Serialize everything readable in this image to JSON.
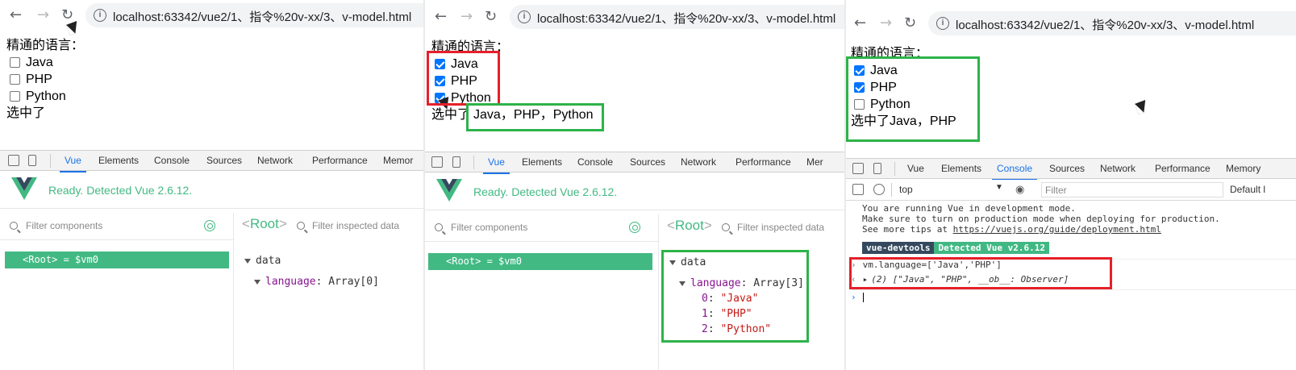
{
  "browser": {
    "url": "localhost:63342/vue2/1、指令%20v-xx/3、v-model.html",
    "url_icon": "info-icon"
  },
  "page": {
    "heading": "精通的语言：",
    "options": [
      "Java",
      "PHP",
      "Python"
    ],
    "selected_label": "选中了"
  },
  "devtools": {
    "tabs": [
      "Vue",
      "Elements",
      "Console",
      "Sources",
      "Network",
      "Performance",
      "Memory"
    ],
    "tabs_trunc": [
      "Vue",
      "Elements",
      "Console",
      "Sources",
      "Network",
      "Performance",
      "Memor"
    ],
    "tabs_trunc2": [
      "Vue",
      "Elements",
      "Console",
      "Sources",
      "Network",
      "Performance",
      "Mer"
    ]
  },
  "vue_panel": {
    "ready_text": "Ready. Detected Vue 2.6.12.",
    "filter_components": "Filter components",
    "filter_inspected": "Filter inspected data",
    "root_tag_open": "<",
    "root_tag_name": "Root",
    "root_tag_close": ">",
    "root_row": "<Root>",
    "root_row_eq": " = ",
    "root_row_vm": "$vm0",
    "data_label": "data",
    "language_key": "language",
    "colon": ": "
  },
  "panel1": {
    "checked": [
      false,
      false,
      false
    ],
    "selected_value": "",
    "language_value": "Array[0]"
  },
  "panel2": {
    "checked": [
      true,
      true,
      true
    ],
    "selected_value": "Java，PHP，Python",
    "language_value": "Array[3]",
    "items": [
      {
        "index": "0",
        "value": "\"Java\""
      },
      {
        "index": "1",
        "value": "\"PHP\""
      },
      {
        "index": "2",
        "value": "\"Python\""
      }
    ]
  },
  "panel3": {
    "checked": [
      true,
      true,
      false
    ],
    "selected_value": " Java，PHP",
    "console": {
      "context": "top",
      "filter_placeholder": "Filter",
      "levels": "Default l",
      "dev_msg_1": "You are running Vue in development mode.",
      "dev_msg_2": "Make sure to turn on production mode when deploying for production.",
      "dev_msg_3_prefix": "See more tips at ",
      "dev_msg_3_link": "https://vuejs.org/guide/deployment.html",
      "badge_1": "vue-devtools",
      "badge_2": "Detected Vue v2.6.12",
      "input_cmd": "vm.language=['Java','PHP']",
      "result": "(2) [\"Java\", \"PHP\", __ob__: Observer]"
    }
  },
  "colors": {
    "vue_green": "#42b983",
    "highlight_red": "#e5202a",
    "highlight_green": "#2db34a",
    "devtools_blue": "#1a73e8"
  }
}
